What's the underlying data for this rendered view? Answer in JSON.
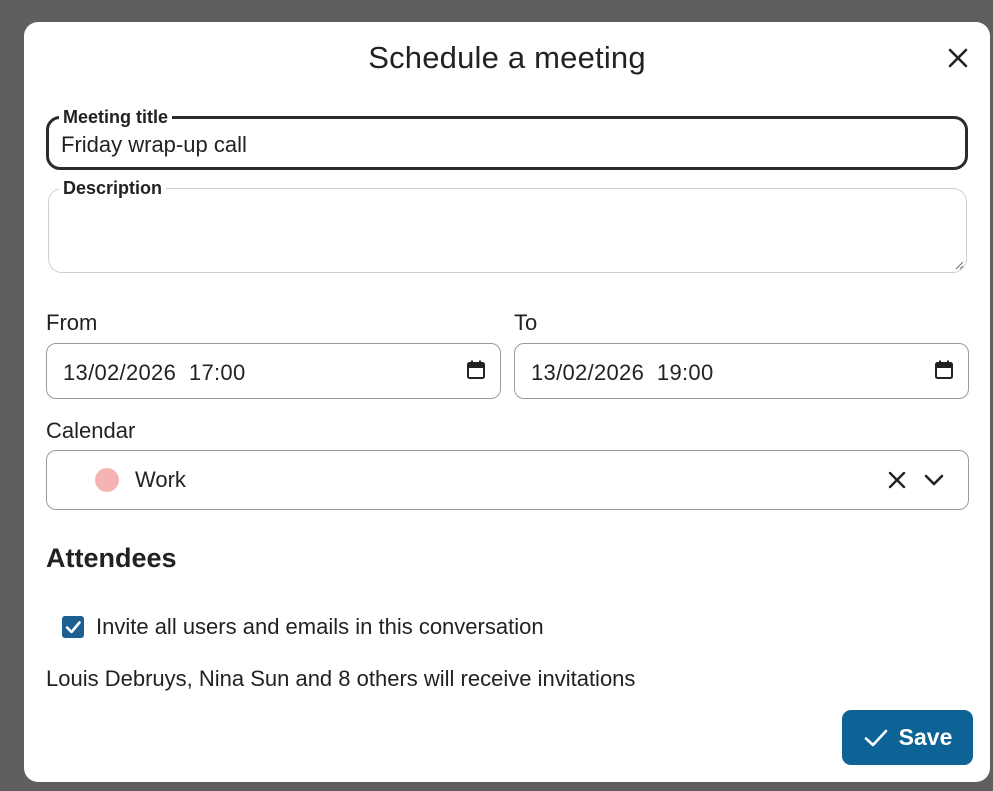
{
  "dialog": {
    "title": "Schedule a meeting",
    "close_icon": "close-icon"
  },
  "form": {
    "title_field": {
      "label": "Meeting title",
      "value": "Friday wrap-up call"
    },
    "description_field": {
      "label": "Description",
      "value": ""
    },
    "from": {
      "label": "From",
      "value": "13/02/2026  17:00",
      "icon": "calendar-icon"
    },
    "to": {
      "label": "To",
      "value": "13/02/2026  19:00",
      "icon": "calendar-icon"
    },
    "calendar": {
      "label": "Calendar",
      "value": "Work",
      "color": "#f4b5b2",
      "clear_icon": "clear-icon",
      "dropdown_icon": "chevron-down-icon"
    }
  },
  "attendees": {
    "heading": "Attendees",
    "invite_all": {
      "label": "Invite all users and emails in this conversation",
      "checked": true
    },
    "summary": "Louis Debruys, Nina Sun and 8 others will receive invitations"
  },
  "actions": {
    "save_label": "Save",
    "save_icon": "check-icon"
  },
  "colors": {
    "accent": "#0e6396",
    "checkbox": "#1d5f91",
    "backdrop": "#5f5f5f"
  }
}
